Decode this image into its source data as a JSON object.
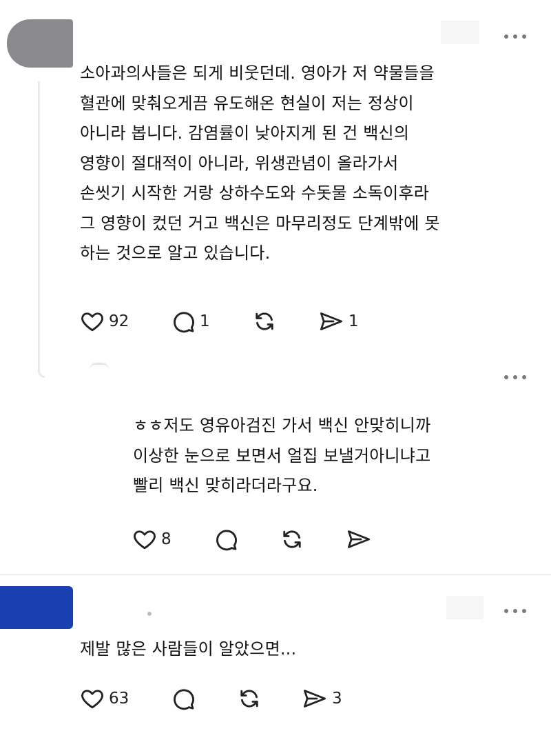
{
  "posts": [
    {
      "lines": [
        "소아과의사들은 되게 비웃던데. 영아가 저 약물들을",
        "혈관에 맞춰오게끔 유도해온 현실이 저는 정상이",
        "아니라 봅니다. 감염률이 낮아지게 된 건 백신의",
        "영향이 절대적이 아니라, 위생관념이 올라가서",
        "손씻기 시작한 거랑 상하수도와 수돗물 소독이후라",
        "그 영향이 컸던 거고 백신은 마무리정도 단계밖에 못",
        "하는 것으로 알고 있습니다."
      ],
      "likes": "92",
      "comments": "1",
      "reposts": "",
      "shares": "1"
    },
    {
      "lines": [
        "ㅎㅎ저도 영유아검진 가서 백신 안맞히니까",
        "이상한 눈으로 보면서 얼집 보낼거아니냐고",
        "빨리 백신 맞히라더라구요."
      ],
      "likes": "8",
      "comments": "",
      "reposts": "",
      "shares": ""
    },
    {
      "lines": [
        "제발 많은 사람들이 알았으면..."
      ],
      "likes": "63",
      "comments": "",
      "reposts": "",
      "shares": "3"
    }
  ],
  "icons": {
    "like": "heart-icon",
    "comment": "comment-bubble-icon",
    "repost": "repost-arrows-icon",
    "share": "send-paper-plane-icon",
    "more": "more-dots-icon"
  },
  "colors": {
    "text": "#111111",
    "icon": "#222222",
    "avatar_redacted_1": "#8a8a8e",
    "avatar_redacted_3": "#1a3fb0",
    "divider": "#efefef"
  }
}
